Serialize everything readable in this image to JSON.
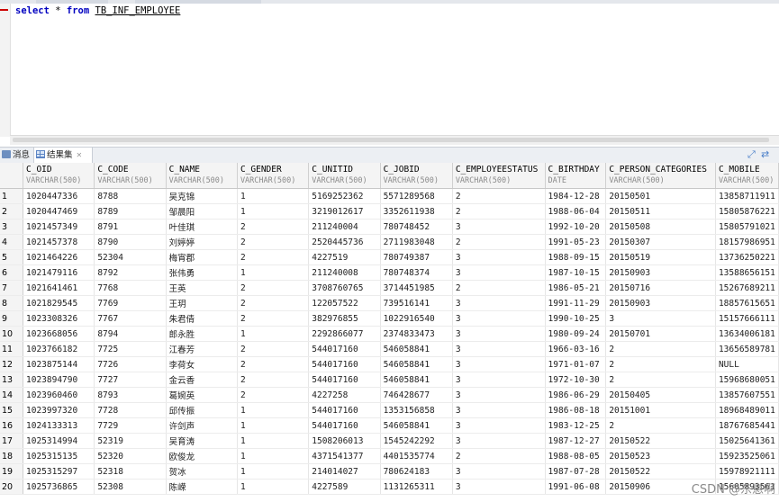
{
  "editor": {
    "sql": {
      "keyword_select": "select",
      "star": " * ",
      "keyword_from": "from",
      "table": "TB_INF_EMPLOYEE"
    }
  },
  "result_tabs": {
    "messages_label": "消息",
    "resultset_label": "结果集"
  },
  "columns": [
    {
      "name": "C_OID",
      "type": "VARCHAR(500)"
    },
    {
      "name": "C_CODE",
      "type": "VARCHAR(500)"
    },
    {
      "name": "C_NAME",
      "type": "VARCHAR(500)"
    },
    {
      "name": "C_GENDER",
      "type": "VARCHAR(500)"
    },
    {
      "name": "C_UNITID",
      "type": "VARCHAR(500)"
    },
    {
      "name": "C_JOBID",
      "type": "VARCHAR(500)"
    },
    {
      "name": "C_EMPLOYEESTATUS",
      "type": "VARCHAR(500)"
    },
    {
      "name": "C_BIRTHDAY",
      "type": "DATE"
    },
    {
      "name": "C_PERSON_CATEGORIES",
      "type": "VARCHAR(500)"
    },
    {
      "name": "C_MOBILE",
      "type": "VARCHAR(500)"
    }
  ],
  "rows": [
    [
      "1",
      "1020447336",
      "8788",
      "吴克锦",
      "1",
      "5169252362",
      "5571289568",
      "2",
      "1984-12-28",
      "20150501",
      "13858711911"
    ],
    [
      "2",
      "1020447469",
      "8789",
      "邹晨阳",
      "1",
      "3219012617",
      "3352611938",
      "2",
      "1988-06-04",
      "20150511",
      "15805876221"
    ],
    [
      "3",
      "1021457349",
      "8791",
      "叶佳琪",
      "2",
      "211240004",
      "780748452",
      "3",
      "1992-10-20",
      "20150508",
      "15805791021"
    ],
    [
      "4",
      "1021457378",
      "8790",
      "刘婷婷",
      "2",
      "2520445736",
      "2711983048",
      "2",
      "1991-05-23",
      "20150307",
      "18157986951"
    ],
    [
      "5",
      "1021464226",
      "52304",
      "梅宵郡",
      "2",
      "4227519",
      "780749387",
      "3",
      "1988-09-15",
      "20150519",
      "13736250221"
    ],
    [
      "6",
      "1021479116",
      "8792",
      "张伟勇",
      "1",
      "211240008",
      "780748374",
      "3",
      "1987-10-15",
      "20150903",
      "13588656151"
    ],
    [
      "7",
      "1021641461",
      "7768",
      "王英",
      "2",
      "3708760765",
      "3714451985",
      "2",
      "1986-05-21",
      "20150716",
      "15267689211"
    ],
    [
      "8",
      "1021829545",
      "7769",
      "王玥",
      "2",
      "122057522",
      "739516141",
      "3",
      "1991-11-29",
      "20150903",
      "18857615651"
    ],
    [
      "9",
      "1023308326",
      "7767",
      "朱君倩",
      "2",
      "382976855",
      "1022916540",
      "3",
      "1990-10-25",
      "3",
      "15157666111"
    ],
    [
      "10",
      "1023668056",
      "8794",
      "郎永胜",
      "1",
      "2292866077",
      "2374833473",
      "3",
      "1980-09-24",
      "20150701",
      "13634006181"
    ],
    [
      "11",
      "1023766182",
      "7725",
      "江春芳",
      "2",
      "544017160",
      "546058841",
      "3",
      "1966-03-16",
      "2",
      "13656589781"
    ],
    [
      "12",
      "1023875144",
      "7726",
      "李荷女",
      "2",
      "544017160",
      "546058841",
      "3",
      "1971-01-07",
      "2",
      "NULL"
    ],
    [
      "13",
      "1023894790",
      "7727",
      "金云香",
      "2",
      "544017160",
      "546058841",
      "3",
      "1972-10-30",
      "2",
      "15968680051"
    ],
    [
      "14",
      "1023960460",
      "8793",
      "葛婉英",
      "2",
      "4227258",
      "746428677",
      "3",
      "1986-06-29",
      "20150405",
      "13857607551"
    ],
    [
      "15",
      "1023997320",
      "7728",
      "邱传振",
      "1",
      "544017160",
      "1353156858",
      "3",
      "1986-08-18",
      "20151001",
      "18968489011"
    ],
    [
      "16",
      "1024133313",
      "7729",
      "许剑声",
      "1",
      "544017160",
      "546058841",
      "3",
      "1983-12-25",
      "2",
      "18767685441"
    ],
    [
      "17",
      "1025314994",
      "52319",
      "吴育涛",
      "1",
      "1508206013",
      "1545242292",
      "3",
      "1987-12-27",
      "20150522",
      "15025641361"
    ],
    [
      "18",
      "1025315135",
      "52320",
      "欧俊龙",
      "1",
      "4371541377",
      "4401535774",
      "2",
      "1988-08-05",
      "20150523",
      "15923525061"
    ],
    [
      "19",
      "1025315297",
      "52318",
      "贺冰",
      "1",
      "214014027",
      "780624183",
      "3",
      "1987-07-28",
      "20150522",
      "15978921111"
    ],
    [
      "20",
      "1025736865",
      "52308",
      "陈嵘",
      "1",
      "4227589",
      "1131265311",
      "3",
      "1991-06-08",
      "20150906",
      "15605893561"
    ]
  ],
  "watermark": "CSDN @东崽啊"
}
